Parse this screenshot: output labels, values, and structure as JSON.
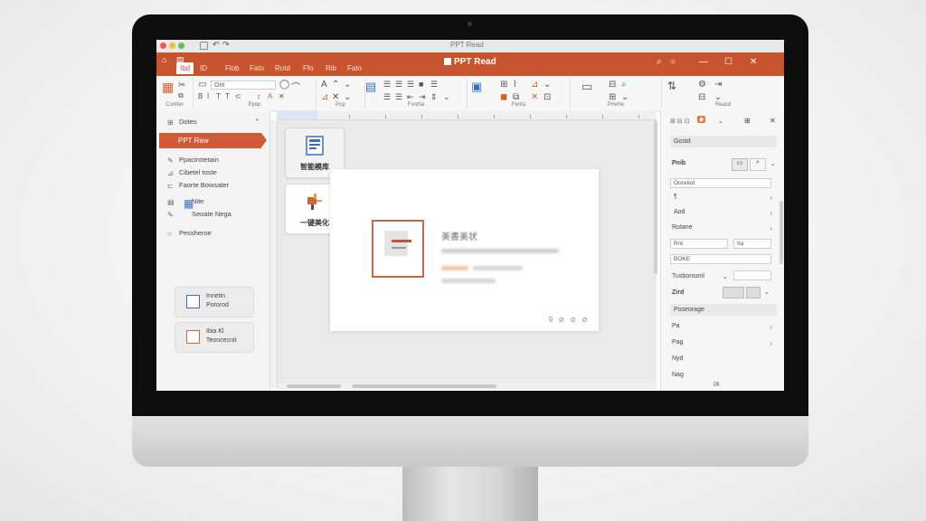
{
  "window": {
    "title": "PPT Read",
    "app_title": "PPT Read"
  },
  "ribbon": {
    "tabs": [
      "Ibd",
      "ID",
      "Flob",
      "Fato",
      "Rotd",
      "Ffo",
      "Rib",
      "Fato"
    ],
    "font_name": "Ont",
    "groups": [
      "Contter",
      "Ppop",
      "Pop",
      "Fonrtia",
      "Fenta",
      "Pnwhe",
      "Reacd"
    ]
  },
  "left_pane": {
    "header": "Dotes",
    "active_item": "PPT Rew",
    "items": [
      "Ppacirotetain",
      "Cibetel toste",
      "Faorte Bowsater",
      "Nite",
      "Seoate Nega",
      "Pessheroe"
    ],
    "cards": [
      {
        "line1": "Innetin",
        "line2": "Pororod"
      },
      {
        "line1": "Ibia Kl",
        "line2": "Teoncecnit"
      }
    ]
  },
  "canvas": {
    "buttons": [
      {
        "label": "智能模库"
      },
      {
        "label": "一键美化"
      }
    ],
    "slide": {
      "title": "美書美状",
      "tools": "9 ⊘ ⊘ ⊘"
    }
  },
  "right_pane": {
    "header_dropdown": "Gostd",
    "section_label": "Pnib",
    "field_dropdown": "Oorelod",
    "rows": [
      "Aod",
      "Rotane"
    ],
    "boxes": [
      "Rnt",
      "Ita",
      "BOKE"
    ],
    "transparency_label": "Tusbonsonl",
    "color_label": "Zird",
    "section2": "Poseorage",
    "list": [
      "Pa",
      "Pag",
      "Nyd",
      "Nag"
    ],
    "footer": "IX"
  },
  "colors": {
    "accent": "#c8532f",
    "accent_active": "#cf5a36",
    "blue": "#3d6fb8"
  }
}
